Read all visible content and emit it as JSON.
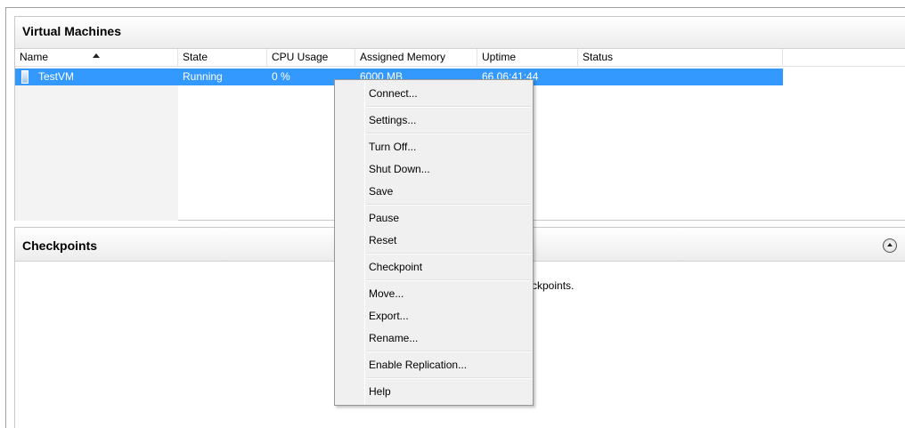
{
  "vm_panel": {
    "title": "Virtual Machines",
    "columns": [
      "Name",
      "State",
      "CPU Usage",
      "Assigned Memory",
      "Uptime",
      "Status"
    ],
    "rows": [
      {
        "name": "TestVM",
        "state": "Running",
        "cpu": "0 %",
        "memory": "6000 MB",
        "uptime": "66.06:41:44",
        "status": ""
      }
    ]
  },
  "checkpoints_panel": {
    "title": "Checkpoints",
    "empty_text": "ckpoints."
  },
  "context_menu": {
    "items": [
      "Connect...",
      "Settings...",
      "Turn Off...",
      "Shut Down...",
      "Save",
      "Pause",
      "Reset",
      "Checkpoint",
      "Move...",
      "Export...",
      "Rename...",
      "Enable Replication...",
      "Help"
    ]
  },
  "colors": {
    "selection": "#3399ff",
    "menu_bg": "#f0f0f0"
  }
}
